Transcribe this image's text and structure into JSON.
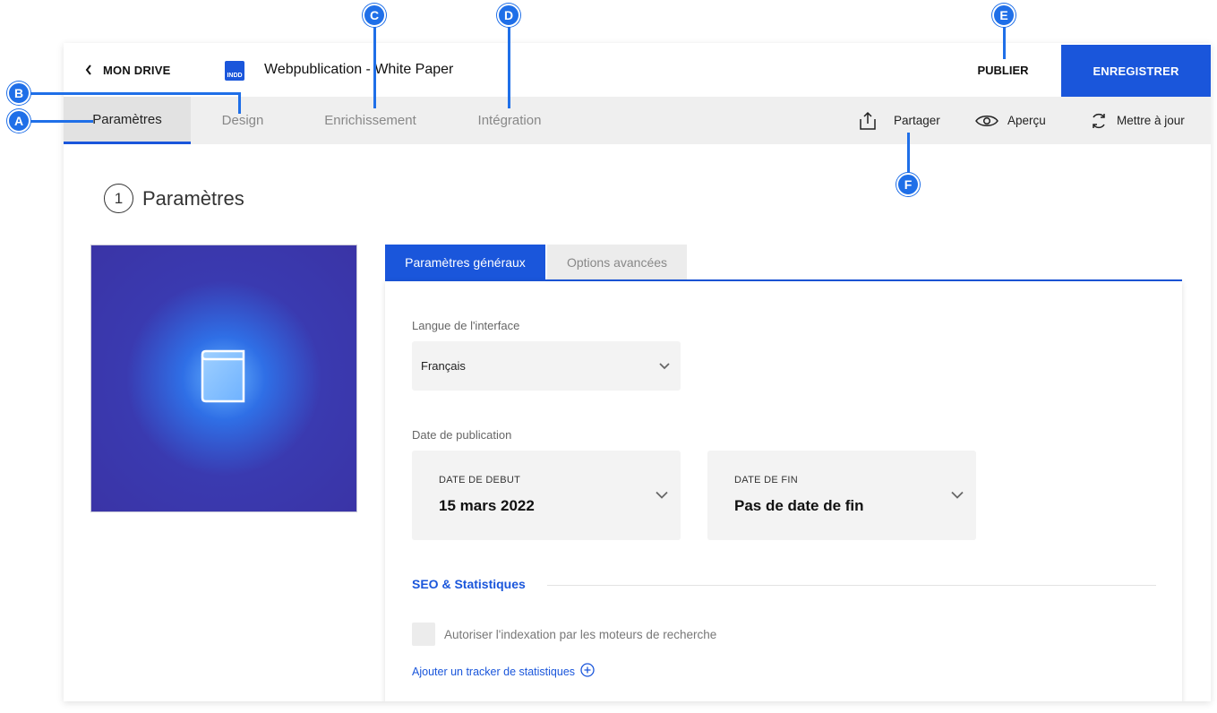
{
  "topbar": {
    "back_label": "MON DRIVE",
    "doc_badge": "INDD",
    "doc_title": "Webpublication - White Paper",
    "publish_label": "PUBLIER",
    "save_label": "ENREGISTRER"
  },
  "main_tabs": [
    {
      "label": "Paramètres",
      "active": true
    },
    {
      "label": "Design",
      "active": false
    },
    {
      "label": "Enrichissement",
      "active": false
    },
    {
      "label": "Intégration",
      "active": false
    }
  ],
  "toolbar_actions": [
    {
      "label": "Partager",
      "icon": "share-icon"
    },
    {
      "label": "Aperçu",
      "icon": "eye-icon"
    },
    {
      "label": "Mettre à jour",
      "icon": "refresh-icon"
    }
  ],
  "section": {
    "step": "1",
    "title": "Paramètres"
  },
  "settings_tabs": [
    {
      "label": "Paramètres généraux",
      "active": true
    },
    {
      "label": "Options avancées",
      "active": false
    }
  ],
  "form": {
    "interface_language_label": "Langue de l'interface",
    "interface_language_value": "Français",
    "publication_date_label": "Date de publication",
    "start_date_label": "DATE DE DEBUT",
    "start_date_value": "15 mars 2022",
    "end_date_label": "DATE DE FIN",
    "end_date_value": "Pas de date de fin",
    "seo_title": "SEO & Statistiques",
    "indexing_label": "Autoriser l'indexation par les moteurs de recherche",
    "indexing_checked": false,
    "add_tracker_label": "Ajouter un tracker de statistiques"
  },
  "annotations": [
    "A",
    "B",
    "C",
    "D",
    "E",
    "F"
  ],
  "colors": {
    "accent": "#1a56db",
    "marker": "#1f6fe8"
  }
}
